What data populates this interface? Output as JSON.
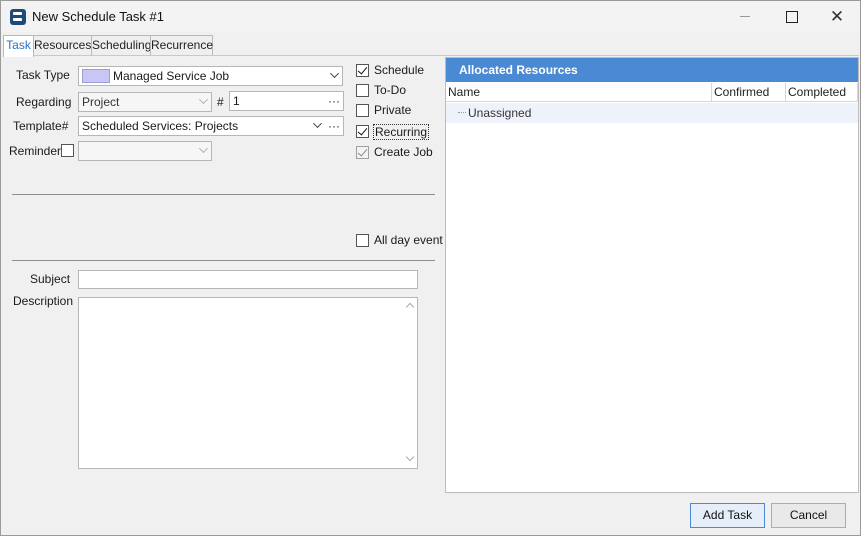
{
  "window": {
    "title": "New Schedule Task #1",
    "minimize_label": "",
    "close_glyph": "✕"
  },
  "tabs": [
    {
      "label": "Task",
      "active": true
    },
    {
      "label": "Resources",
      "active": false
    },
    {
      "label": "Scheduling",
      "active": false
    },
    {
      "label": "Recurrence",
      "active": false
    }
  ],
  "form": {
    "task_type": {
      "label": "Task Type",
      "value": "Managed Service Job",
      "swatch_color": "#c8c6f5"
    },
    "regarding": {
      "label": "Regarding",
      "value": "Project",
      "hash_label": "#",
      "number_value": "1"
    },
    "template": {
      "label": "Template#",
      "value": "Scheduled Services: Projects"
    },
    "reminder": {
      "label": "Reminder",
      "checked": false,
      "value": ""
    },
    "ellipsis": "···",
    "options": {
      "schedule": {
        "label": "Schedule",
        "checked": true
      },
      "todo": {
        "label": "To-Do",
        "checked": false
      },
      "private": {
        "label": "Private",
        "checked": false
      },
      "recurring": {
        "label": "Recurring",
        "checked": true
      },
      "create_job": {
        "label": "Create Job",
        "checked": true,
        "disabled": true
      }
    },
    "all_day_event": {
      "label": "All day event",
      "checked": false
    },
    "subject": {
      "label": "Subject",
      "value": ""
    },
    "description": {
      "label": "Description",
      "value": ""
    }
  },
  "resources": {
    "header": "Allocated Resources",
    "columns": [
      "Name",
      "Confirmed",
      "Completed"
    ],
    "rows": [
      {
        "name": "Unassigned",
        "confirmed": "",
        "completed": ""
      }
    ]
  },
  "footer": {
    "add_task_label": "Add Task",
    "cancel_label": "Cancel"
  },
  "colors": {
    "accent": "#4a89d4",
    "active_tab_text": "#2a72c5"
  }
}
